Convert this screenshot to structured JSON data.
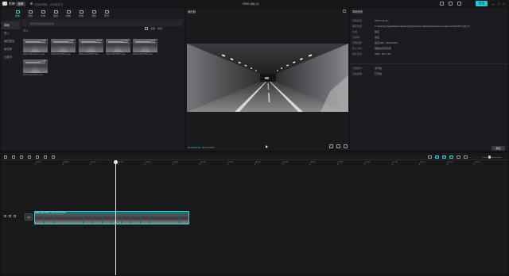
{
  "titlebar": {
    "app_name": "剪映",
    "menu_label": "菜单",
    "autosave_text": "已保存草稿，自动保存中",
    "window_title": "0309-1(8) (1)",
    "export_label": "导出",
    "minimize": "—",
    "maximize": "□",
    "close": "×"
  },
  "top_tabs": [
    {
      "label": "媒体"
    },
    {
      "label": "音频"
    },
    {
      "label": "文本"
    },
    {
      "label": "贴纸"
    },
    {
      "label": "特效"
    },
    {
      "label": "转场"
    },
    {
      "label": "滤镜"
    },
    {
      "label": "调节"
    }
  ],
  "side_nav": [
    {
      "label": "本地"
    },
    {
      "label": "导入"
    },
    {
      "label": "我的预设"
    },
    {
      "label": "素材库"
    },
    {
      "label": "云素材"
    }
  ],
  "media": {
    "search_placeholder": "搜索文件名称或文件夹",
    "section_label": "导入",
    "sort_label": "全部",
    "view_label": "排序",
    "items": [
      {
        "name": "0305-1(8)-0303-1.mp4",
        "duration": "00:24"
      },
      {
        "name": "0305-1(8)-0304.mp4",
        "duration": "00:18"
      },
      {
        "name": "0305-1(8)-0306.mp4",
        "duration": "00:31"
      },
      {
        "name": "0305-1(8)-0307.mp4",
        "duration": "00:12"
      },
      {
        "name": "0305-1(8)-0308.mp4",
        "duration": "00:27"
      },
      {
        "name": "0305-1(8)-0309.mp4",
        "duration": "00:09"
      }
    ]
  },
  "player": {
    "title": "播放器",
    "time_current": "00:00:05:13",
    "time_total": "00:03:55:03"
  },
  "details": {
    "title": "草稿参数",
    "rows": [
      {
        "label": "草稿名称",
        "value": "0309-1(8) (1)"
      },
      {
        "label": "保存位置",
        "value": "C:/Users/jy/AppData/Local/JianyingPro/User Data/Projects/com.lveditor.draft/0309-1(8) (1)"
      },
      {
        "label": "比例",
        "value": "适应"
      },
      {
        "label": "分辨率",
        "value": "适应"
      },
      {
        "label": "草稿帧率",
        "value": "适应(30) - 1920*1080"
      },
      {
        "label": "导入方式",
        "value": "保留在原有位置"
      },
      {
        "label": "色彩空间",
        "value": "SDR - Rec.709"
      }
    ],
    "selects": [
      {
        "label": "代理模式",
        "value": "未开启"
      },
      {
        "label": "自由层级",
        "value": "已开启"
      }
    ],
    "modify_label": "修改"
  },
  "timeline": {
    "cover_label": "封面",
    "clip_label": "0305-1(8)-0303-1.mp4  00:00:22:19",
    "ticks": [
      "00:00",
      "00:05",
      "00:10",
      "00:15",
      "00:20",
      "00:25",
      "00:30",
      "00:35",
      "00:40",
      "00:45",
      "00:50",
      "00:55",
      "01:00",
      "01:05",
      "01:10",
      "01:15",
      "01:20"
    ]
  },
  "colors": {
    "accent": "#22c7d2",
    "panel_bg": "#1c1c20",
    "clip_bg": "#1a6a6e"
  }
}
